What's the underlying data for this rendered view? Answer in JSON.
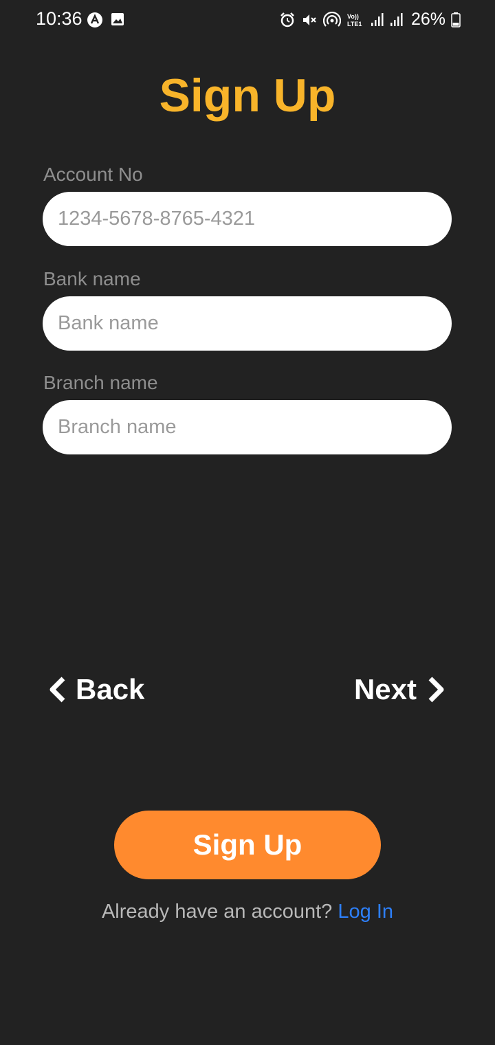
{
  "status_bar": {
    "time": "10:36",
    "battery": "26%",
    "left_icons": [
      "app-icon",
      "image-icon"
    ],
    "right_icons": [
      "alarm-icon",
      "mute-icon",
      "hotspot-icon",
      "volte-icon",
      "signal-icon",
      "signal-icon",
      "battery-icon"
    ]
  },
  "title": "Sign Up",
  "form": {
    "account_no": {
      "label": "Account No",
      "placeholder": "1234-5678-8765-4321"
    },
    "bank_name": {
      "label": "Bank name",
      "placeholder": "Bank name"
    },
    "branch_name": {
      "label": "Branch name",
      "placeholder": "Branch name"
    }
  },
  "nav": {
    "back_label": "Back",
    "next_label": "Next"
  },
  "signup_button": "Sign Up",
  "footer": {
    "prompt": "Already have an account?",
    "login_link": "Log In"
  },
  "colors": {
    "background": "#222222",
    "title": "#f8b42a",
    "button": "#ff8a2e",
    "link": "#2d7ff9"
  }
}
